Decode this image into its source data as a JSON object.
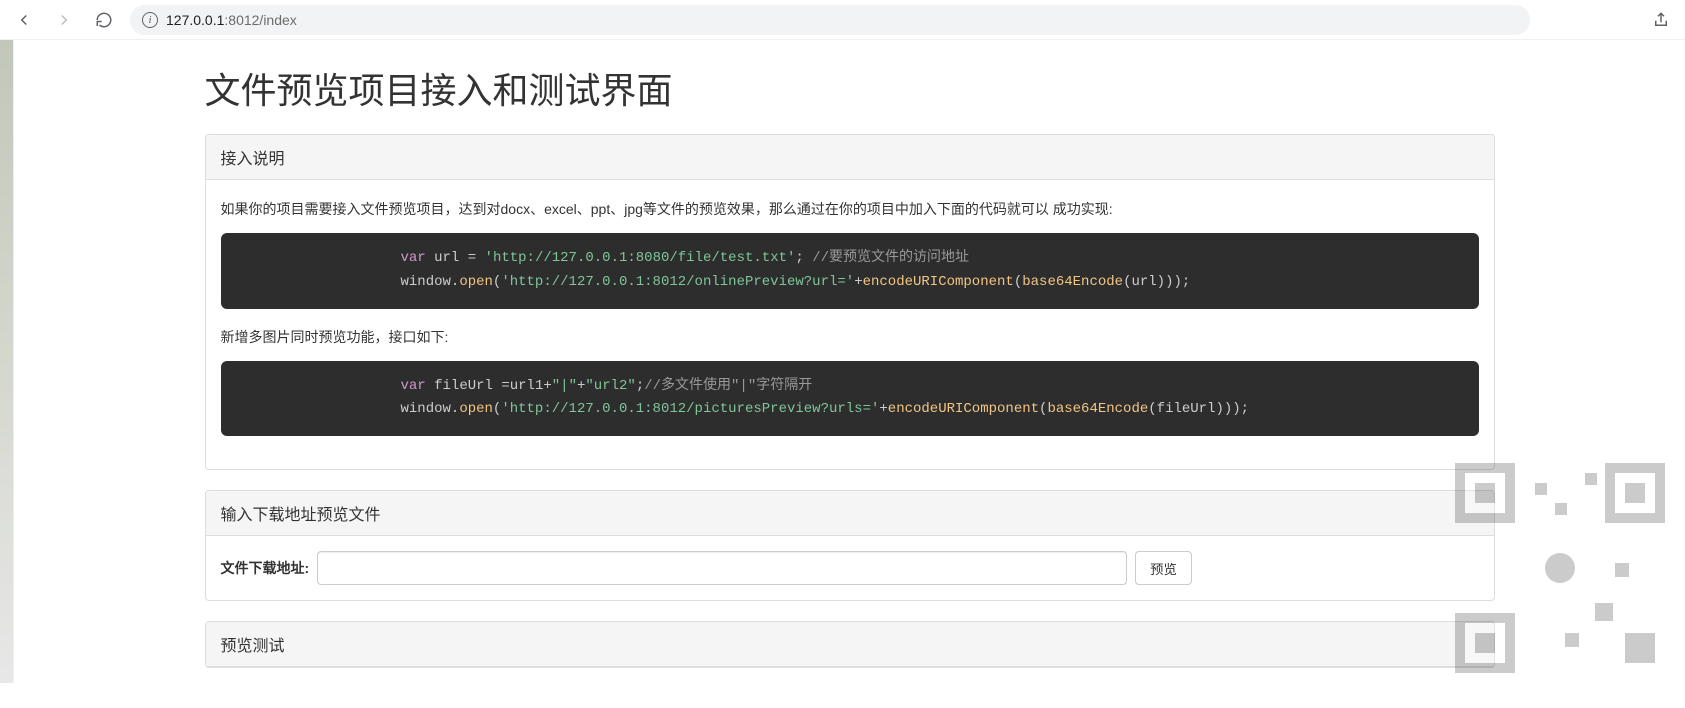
{
  "browser": {
    "url_host": "127.0.0.1",
    "url_port_path": ":8012/index"
  },
  "page": {
    "title": "文件预览项目接入和测试界面"
  },
  "panels": {
    "intro": {
      "heading": "接入说明",
      "desc1": "如果你的项目需要接入文件预览项目，达到对docx、excel、ppt、jpg等文件的预览效果，那么通过在你的项目中加入下面的代码就可以 成功实现:",
      "code1": {
        "kw_var": "var",
        "var_name": " url ",
        "eq": "= ",
        "str1": "'http://127.0.0.1:8080/file/test.txt'",
        "semi1": "; ",
        "cmt1": "//要预览文件的访问地址",
        "l2_pre": "window.",
        "l2_fn": "open",
        "l2_open": "(",
        "l2_str": "'http://127.0.0.1:8012/onlinePreview?url='",
        "l2_plus1": "+",
        "l2_fn2": "encodeURIComponent",
        "l2_open2": "(",
        "l2_fn3": "base64Encode",
        "l2_open3": "(url)));"
      },
      "desc2": "新增多图片同时预览功能，接口如下:",
      "code2": {
        "kw_var": "var",
        "var_name": " fileUrl ",
        "eq": "=url1+",
        "str_sep1": "\"|\"",
        "plus": "+",
        "str_sep2": "\"url2\"",
        "semi": ";",
        "cmt": "//多文件使用\"|\"字符隔开",
        "l2_pre": "window.",
        "l2_fn": "open",
        "l2_open": "(",
        "l2_str": "'http://127.0.0.1:8012/picturesPreview?urls='",
        "l2_plus1": "+",
        "l2_fn2": "encodeURIComponent",
        "l2_open2": "(",
        "l2_fn3": "base64Encode",
        "l2_open3": "(fileUrl)));"
      }
    },
    "input": {
      "heading": "输入下载地址预览文件",
      "label": "文件下载地址:",
      "button": "预览",
      "placeholder": ""
    },
    "test": {
      "heading": "预览测试"
    }
  }
}
